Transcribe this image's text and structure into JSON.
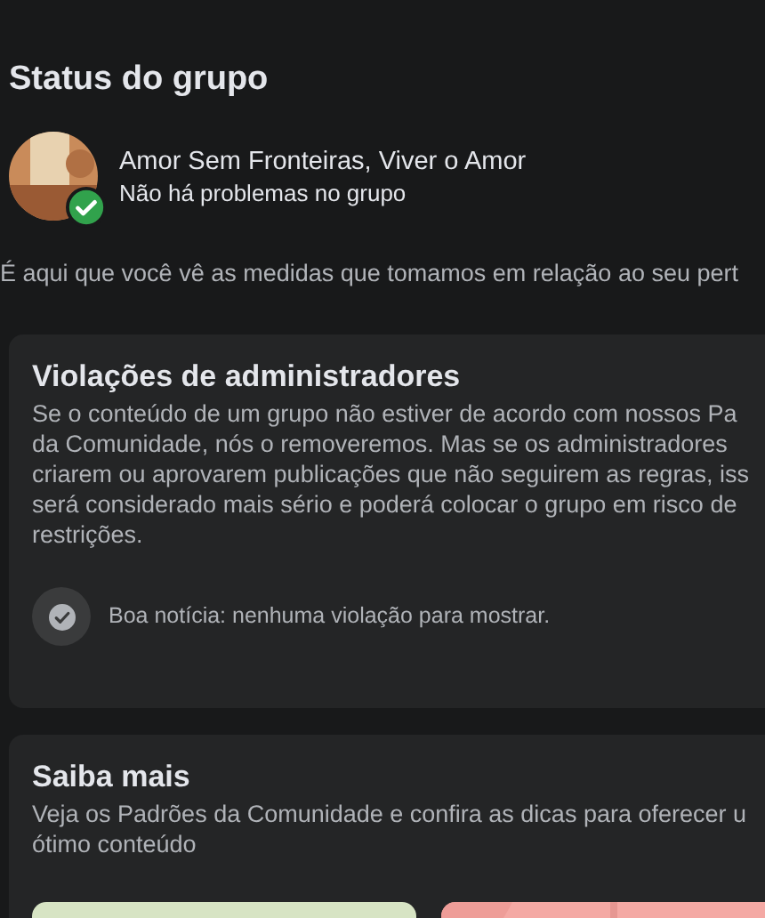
{
  "title": "Status do grupo",
  "group": {
    "name": "Amor Sem Fronteiras, Viver o Amor",
    "status": "Não há problemas no grupo",
    "ok": true
  },
  "intro": "É aqui que você vê as medidas que tomamos em relação ao seu pert",
  "violations": {
    "title": "Violações de administradores",
    "lines": [
      "Se o conteúdo de um grupo não estiver de acordo com nossos Pa",
      "da Comunidade, nós o removeremos. Mas se os administradores",
      "criarem ou aprovarem publicações que não seguirem as regras, iss",
      "será considerado mais sério e poderá colocar o grupo em risco de",
      "restrições."
    ],
    "empty_message": "Boa notícia: nenhuma violação para mostrar."
  },
  "learn_more": {
    "title": "Saiba mais",
    "lines": [
      "Veja os Padrões da Comunidade e confira as dicas para oferecer u",
      "ótimo conteúdo"
    ]
  }
}
